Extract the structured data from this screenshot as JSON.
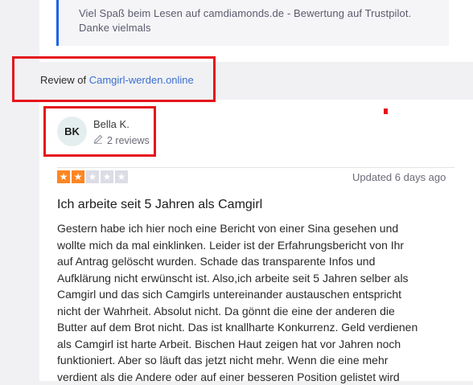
{
  "header": {
    "quote_lines": [
      "Viel Spaß beim Lesen auf camdiamonds.de - Bewertung auf Trustpilot.",
      "Danke vielmals"
    ]
  },
  "review_of": {
    "prefix": "Review of",
    "link_text": "Camgirl-werden.online"
  },
  "author": {
    "initials": "BK",
    "name": "Bella K.",
    "review_count": "2 reviews"
  },
  "review": {
    "rating": 2,
    "max_rating": 5,
    "updated": "Updated 6 days ago",
    "title": "Ich arbeite seit 5 Jahren als Camgirl",
    "body_lines": [
      "Gestern habe ich hier noch eine Bericht von einer Sina gesehen und",
      "wollte mich da mal einklinken. Leider ist der Erfahrungsbericht von Ihr",
      "auf Antrag gelöscht wurden. Schade das transparente Infos und",
      "Aufklärung nicht erwünscht ist. Also,ich arbeite seit 5 Jahren selber als",
      "Camgirl und das sich Camgirls untereinander austauschen entspricht",
      "nicht der Wahrheit. Absolut nicht. Da gönnt die eine der anderen die",
      "Butter auf dem Brot nicht. Das ist knallharte Konkurrenz. Geld verdienen",
      "als Camgirl ist harte Arbeit. Bischen Haut zeigen hat vor Jahren noch",
      "funktioniert. Aber so läuft das jetzt nicht mehr. Wenn die eine mehr",
      "verdient als die Andere oder auf einer besseren Position gelistet wird"
    ]
  },
  "colors": {
    "star_filled": "#ff8622",
    "star_empty": "#dcdce6",
    "link": "#3a6fcf",
    "highlight": "#e4141c",
    "quote_border": "#1c64e8"
  }
}
